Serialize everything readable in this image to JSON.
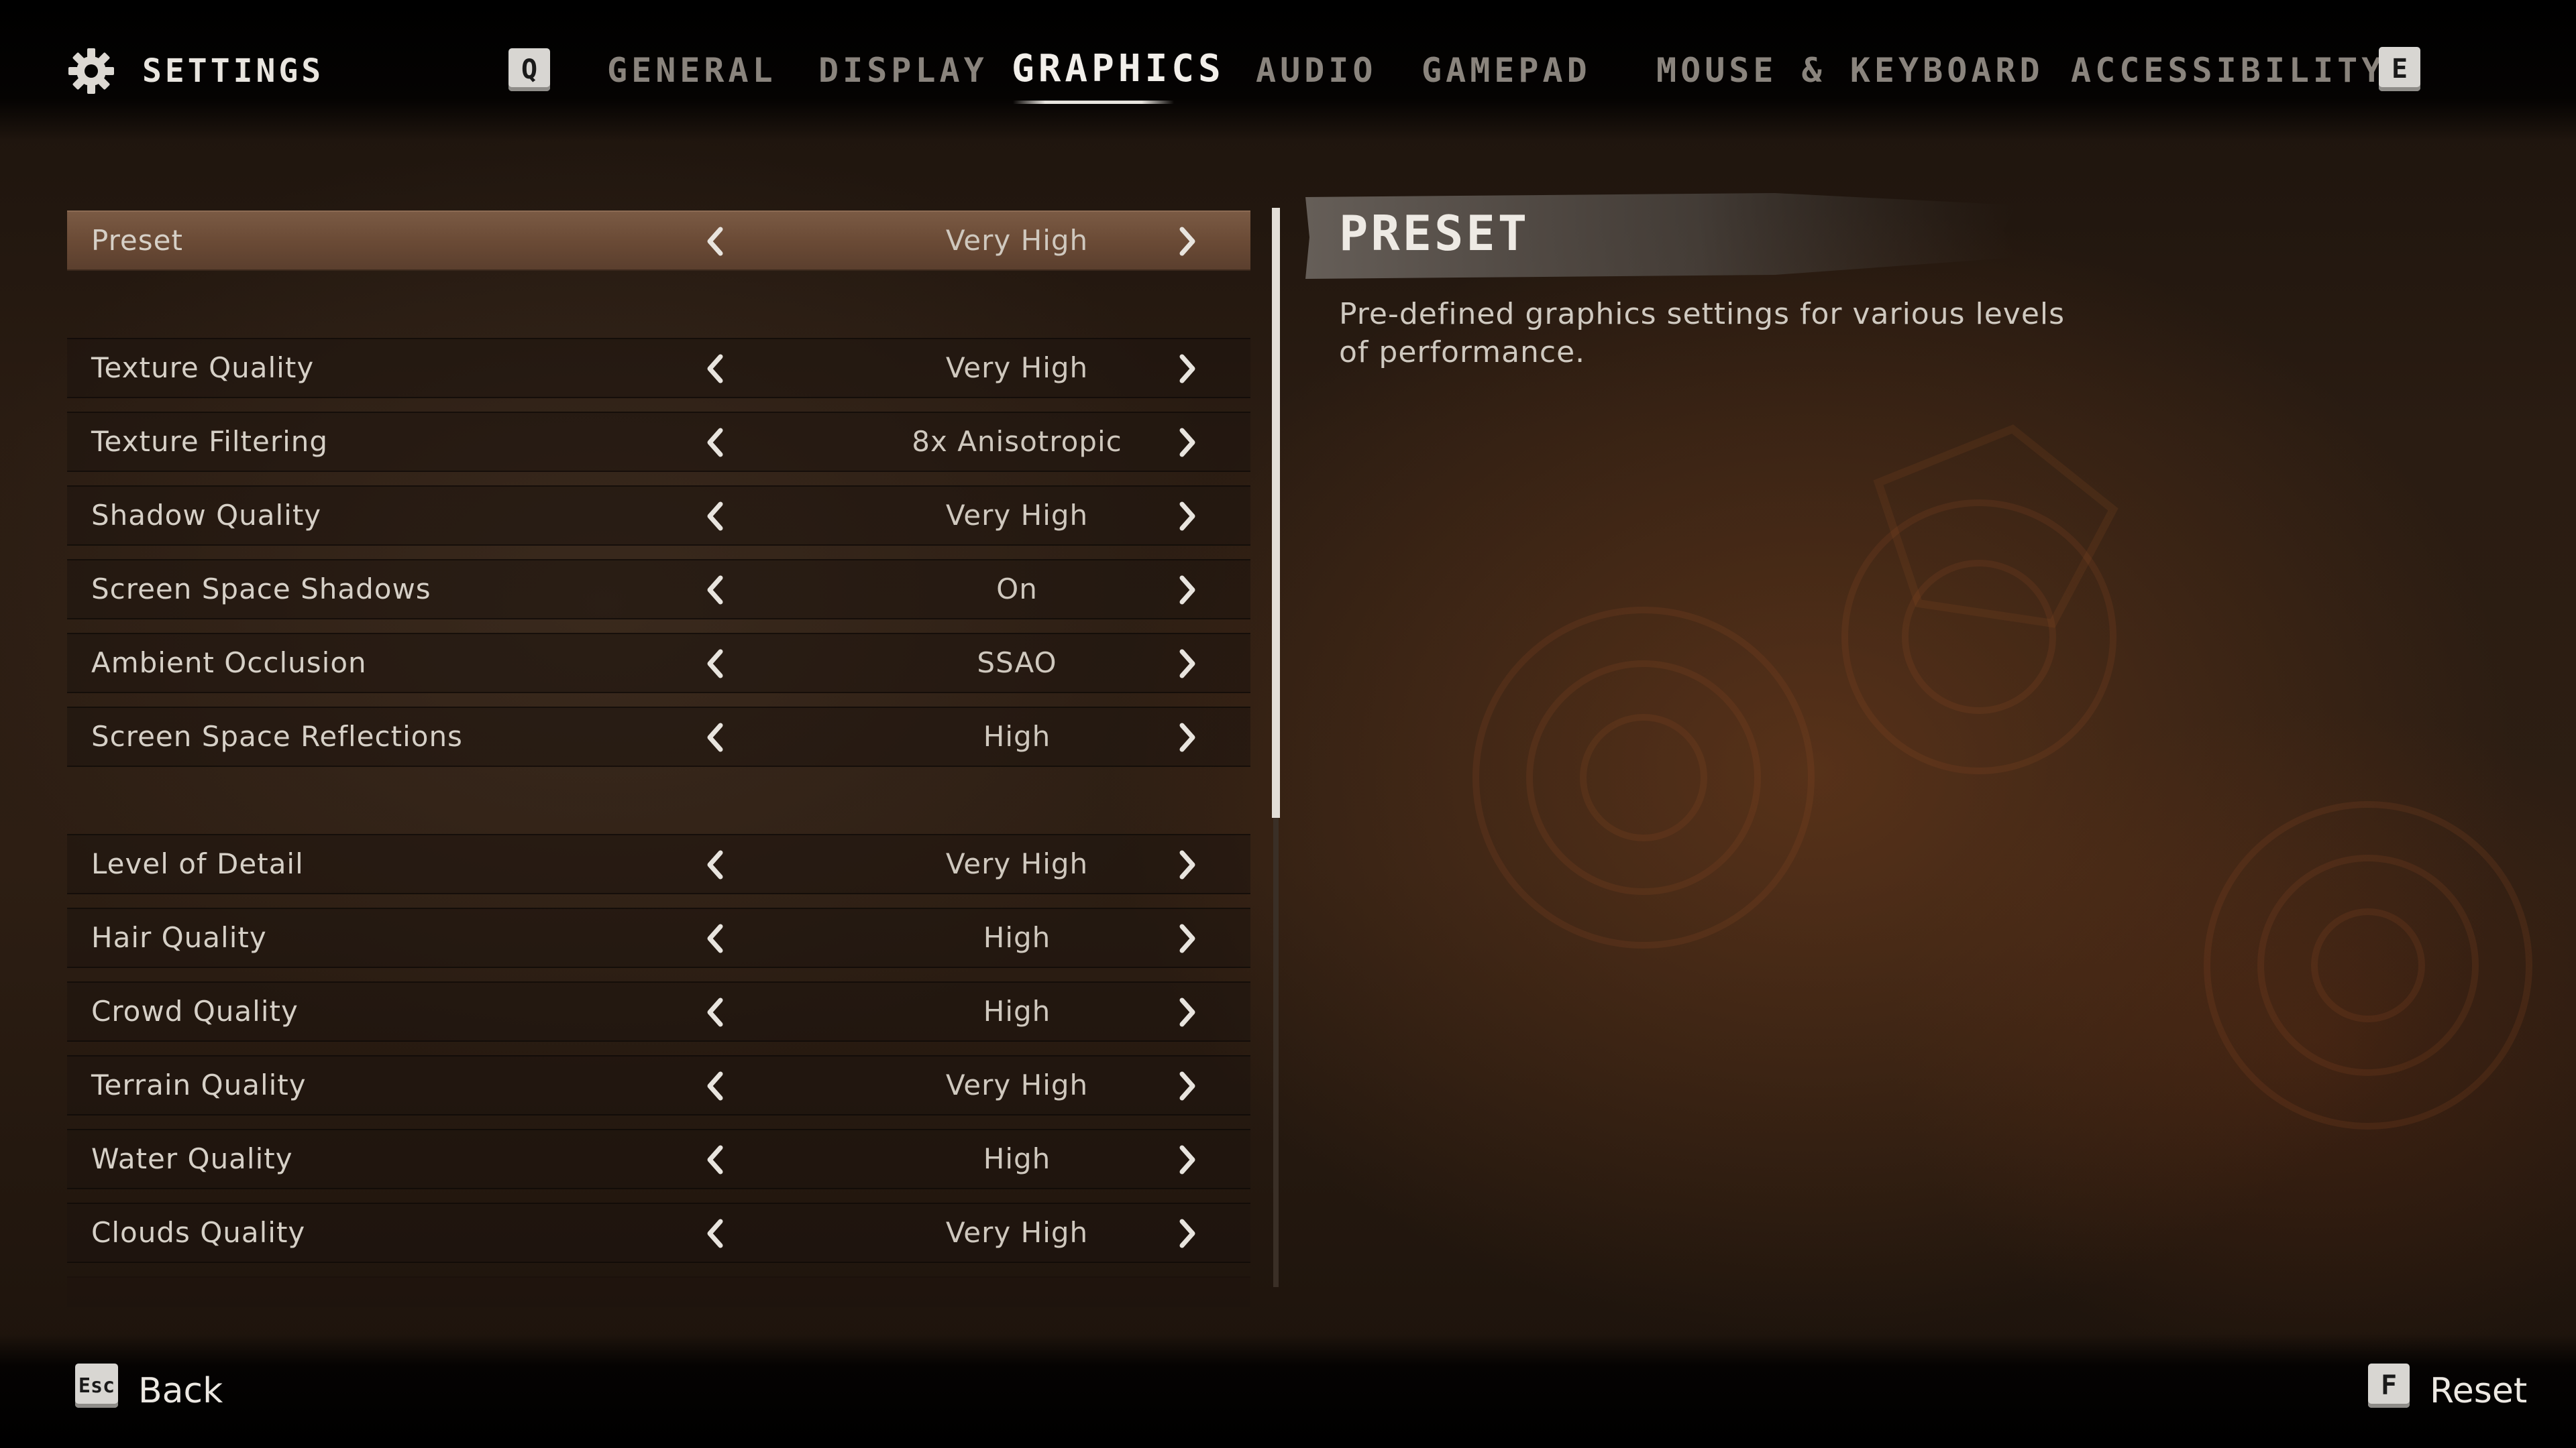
{
  "header": {
    "title": "SETTINGS",
    "prev_key": "Q",
    "next_key": "E",
    "tabs": [
      {
        "label": "GENERAL",
        "active": false
      },
      {
        "label": "DISPLAY",
        "active": false
      },
      {
        "label": "GRAPHICS",
        "active": true
      },
      {
        "label": "AUDIO",
        "active": false
      },
      {
        "label": "GAMEPAD",
        "active": false
      },
      {
        "label": "MOUSE & KEYBOARD",
        "active": false
      },
      {
        "label": "ACCESSIBILITY",
        "active": false
      }
    ]
  },
  "settings": [
    {
      "label": "Preset",
      "value": "Very High",
      "selected": true
    },
    {
      "label": "Texture Quality",
      "value": "Very High"
    },
    {
      "label": "Texture Filtering",
      "value": "8x Anisotropic"
    },
    {
      "label": "Shadow Quality",
      "value": "Very High"
    },
    {
      "label": "Screen Space Shadows",
      "value": "On"
    },
    {
      "label": "Ambient Occlusion",
      "value": "SSAO"
    },
    {
      "label": "Screen Space Reflections",
      "value": "High"
    },
    {
      "label": "Level of Detail",
      "value": "Very High"
    },
    {
      "label": "Hair Quality",
      "value": "High"
    },
    {
      "label": "Crowd Quality",
      "value": "High"
    },
    {
      "label": "Terrain Quality",
      "value": "Very High"
    },
    {
      "label": "Water Quality",
      "value": "High"
    },
    {
      "label": "Clouds Quality",
      "value": "Very High"
    }
  ],
  "description": {
    "title": "PRESET",
    "text": "Pre-defined graphics settings for various levels of performance."
  },
  "footer": {
    "back_key": "Esc",
    "back_label": "Back",
    "reset_key": "F",
    "reset_label": "Reset"
  },
  "icons": {
    "settings": "gear-icon",
    "prev_value": "chevron-left-icon",
    "next_value": "chevron-right-icon"
  },
  "colors": {
    "selected_row": "#6b4b36",
    "active_tab": "#f2efea",
    "inactive_tab": "#8a847d"
  }
}
